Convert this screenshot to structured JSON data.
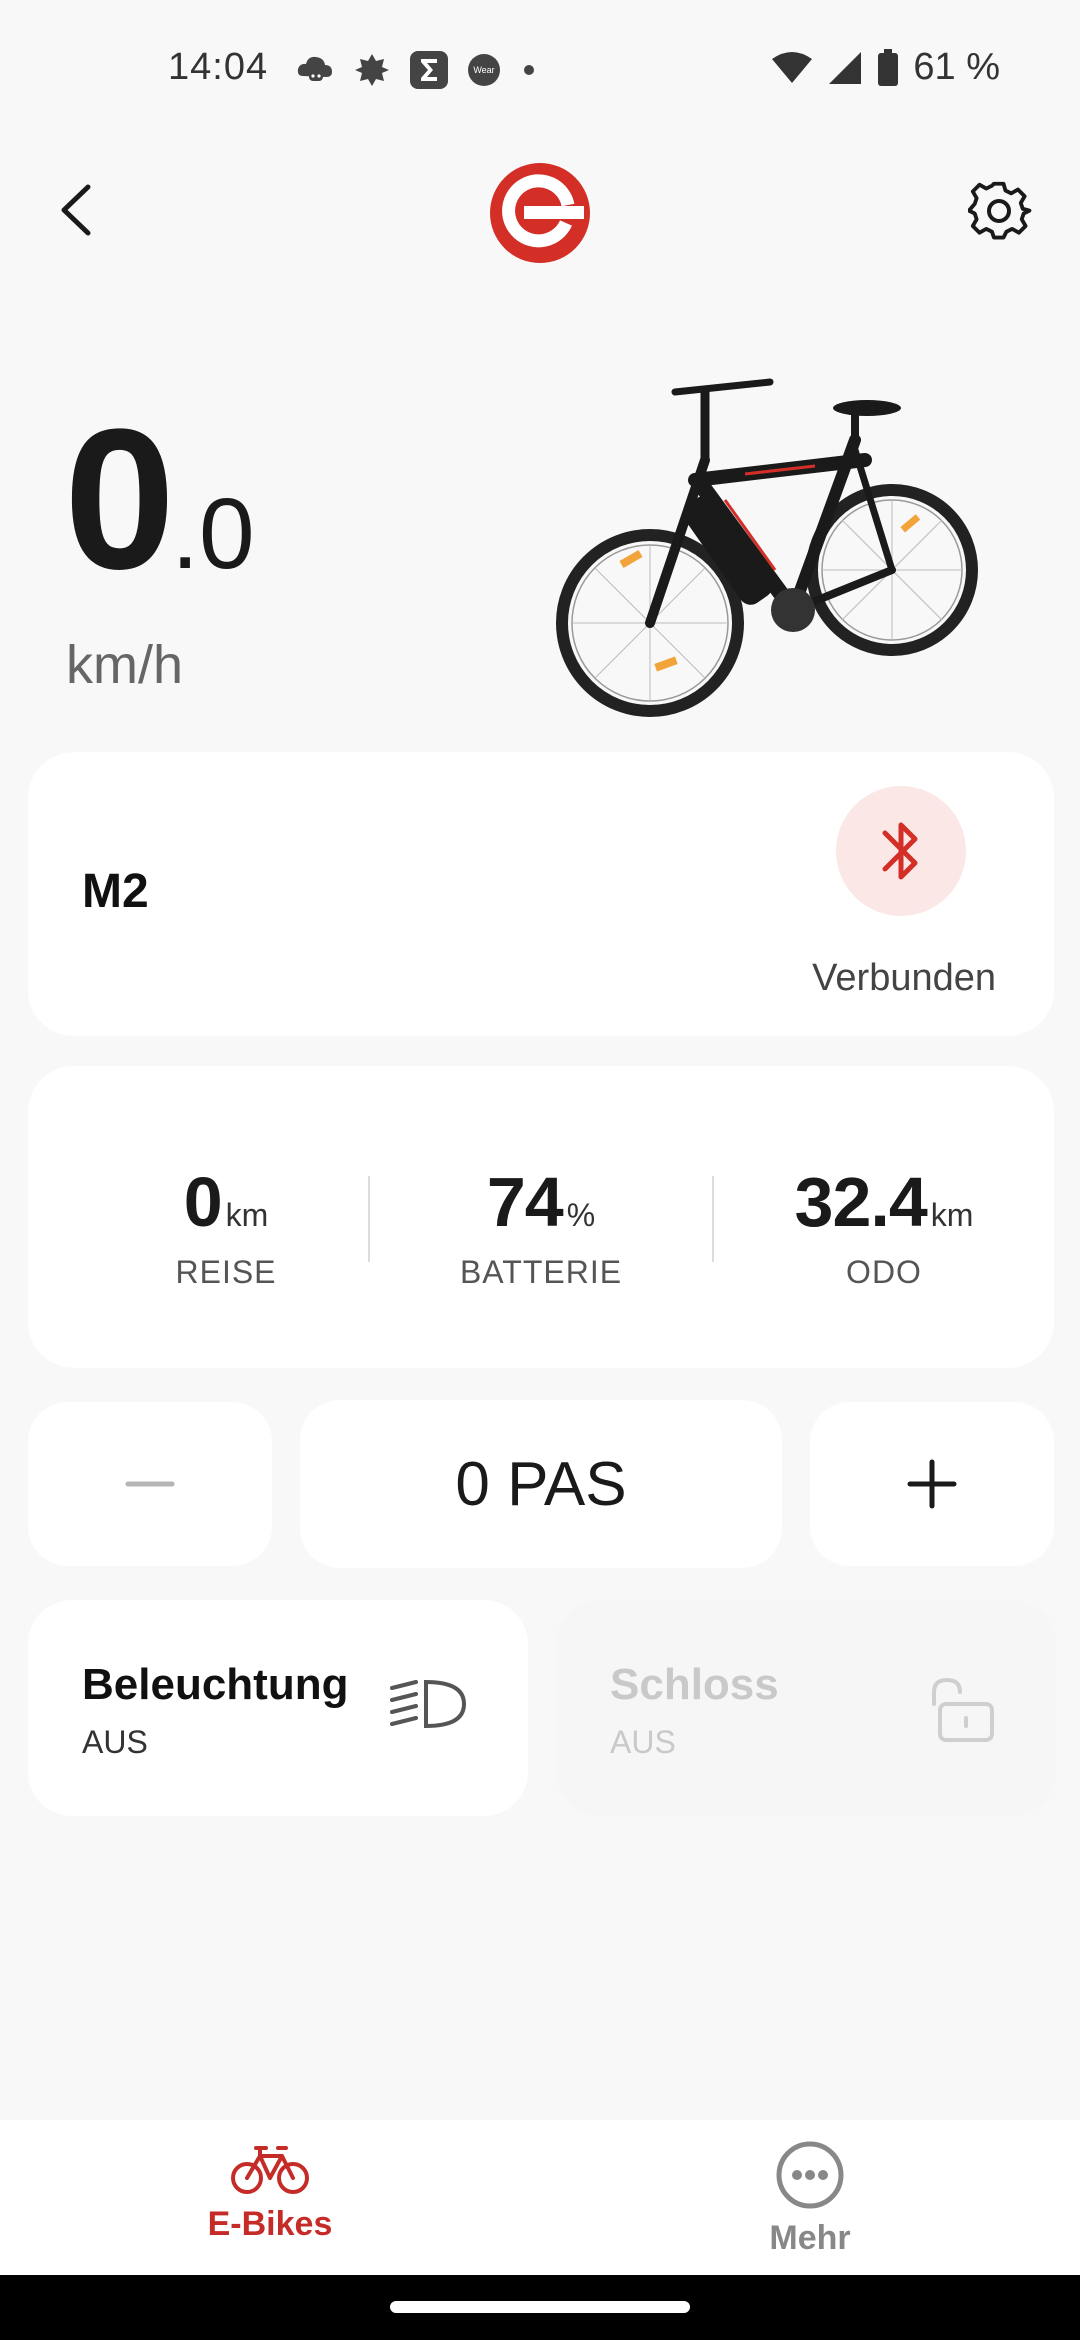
{
  "status_bar": {
    "time": "14:04",
    "notification_icons": [
      "cloud-gamepad-icon",
      "leaf-icon",
      "sigma-app-icon",
      "wear-os-icon",
      "more-dot-icon"
    ],
    "wear_label": "Wear",
    "battery_percent": "61 %"
  },
  "header": {
    "back_icon": "chevron-left-icon",
    "logo_icon": "brand-logo-icon",
    "settings_icon": "gear-icon",
    "brand_color": "#d42f27"
  },
  "speed": {
    "integer": "0",
    "decimal": ".0",
    "unit": "km/h"
  },
  "device": {
    "name": "M2",
    "connection_icon": "bluetooth-icon",
    "status": "Verbunden"
  },
  "stats": [
    {
      "value": "0",
      "unit": "km",
      "label": "REISE"
    },
    {
      "value": "74",
      "unit": "%",
      "label": "BATTERIE"
    },
    {
      "value": "32.4",
      "unit": "km",
      "label": "ODO"
    }
  ],
  "pas": {
    "label": "0 PAS",
    "decrease_icon": "minus-icon",
    "increase_icon": "plus-icon"
  },
  "toggles": {
    "light": {
      "title": "Beleuchtung",
      "state": "AUS",
      "icon": "headlight-icon"
    },
    "lock": {
      "title": "Schloss",
      "state": "AUS",
      "icon": "unlock-icon"
    }
  },
  "bottom_nav": [
    {
      "label": "E-Bikes",
      "icon": "bicycle-icon",
      "active": true
    },
    {
      "label": "Mehr",
      "icon": "more-circle-icon",
      "active": false
    }
  ]
}
